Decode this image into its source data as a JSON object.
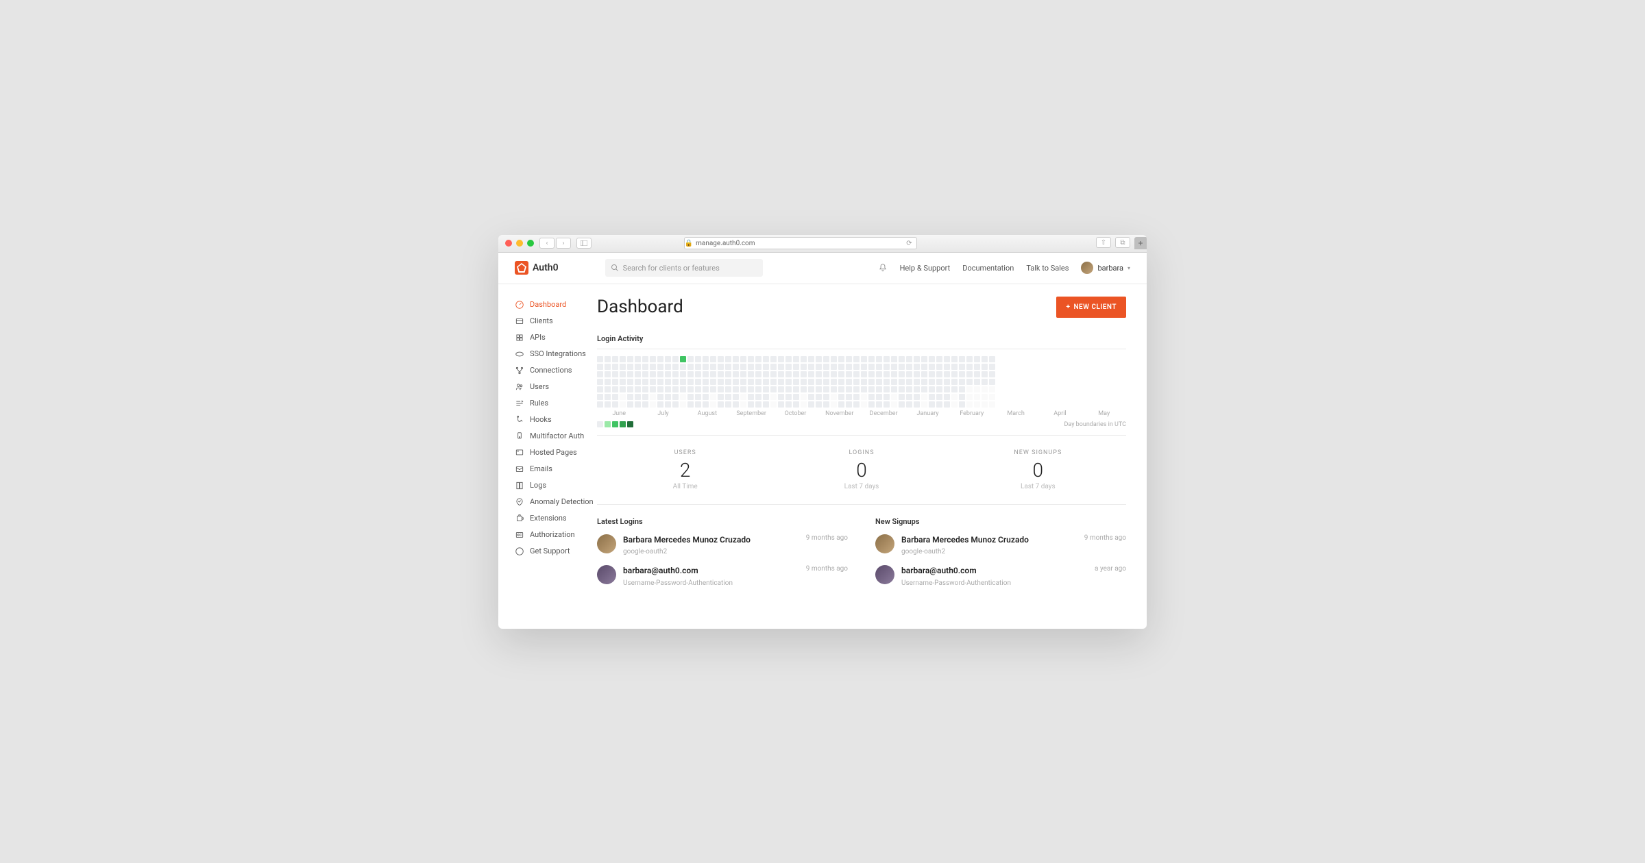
{
  "browser": {
    "url": "manage.auth0.com"
  },
  "brand": "Auth0",
  "search": {
    "placeholder": "Search for clients or features"
  },
  "topnav": {
    "help": "Help & Support",
    "docs": "Documentation",
    "sales": "Talk to Sales",
    "user": "barbara"
  },
  "sidebar": [
    {
      "icon": "dashboard",
      "label": "Dashboard",
      "active": true
    },
    {
      "icon": "clients",
      "label": "Clients"
    },
    {
      "icon": "apis",
      "label": "APIs"
    },
    {
      "icon": "sso",
      "label": "SSO Integrations"
    },
    {
      "icon": "connections",
      "label": "Connections"
    },
    {
      "icon": "users",
      "label": "Users"
    },
    {
      "icon": "rules",
      "label": "Rules"
    },
    {
      "icon": "hooks",
      "label": "Hooks"
    },
    {
      "icon": "mfa",
      "label": "Multifactor Auth"
    },
    {
      "icon": "hosted",
      "label": "Hosted Pages"
    },
    {
      "icon": "emails",
      "label": "Emails"
    },
    {
      "icon": "logs",
      "label": "Logs"
    },
    {
      "icon": "anomaly",
      "label": "Anomaly Detection"
    },
    {
      "icon": "extensions",
      "label": "Extensions"
    },
    {
      "icon": "authorization",
      "label": "Authorization"
    },
    {
      "icon": "support",
      "label": "Get Support"
    }
  ],
  "page": {
    "title": "Dashboard",
    "new_btn": "NEW CLIENT"
  },
  "activity": {
    "title": "Login Activity",
    "months": [
      "June",
      "July",
      "August",
      "September",
      "October",
      "November",
      "December",
      "January",
      "February",
      "March",
      "April",
      "May"
    ],
    "footer": "Day boundaries in UTC"
  },
  "stats": [
    {
      "label": "USERS",
      "value": "2",
      "sub": "All Time"
    },
    {
      "label": "LOGINS",
      "value": "0",
      "sub": "Last 7 days"
    },
    {
      "label": "NEW SIGNUPS",
      "value": "0",
      "sub": "Last 7 days"
    }
  ],
  "lists": {
    "logins": {
      "title": "Latest Logins",
      "items": [
        {
          "name": "Barbara Mercedes Munoz Cruzado",
          "meta": "google-oauth2",
          "time": "9 months ago",
          "av": ""
        },
        {
          "name": "barbara@auth0.com",
          "meta": "Username-Password-Authentication",
          "time": "9 months ago",
          "av": "alt"
        }
      ]
    },
    "signups": {
      "title": "New Signups",
      "items": [
        {
          "name": "Barbara Mercedes Munoz Cruzado",
          "meta": "google-oauth2",
          "time": "9 months ago",
          "av": ""
        },
        {
          "name": "barbara@auth0.com",
          "meta": "Username-Password-Authentication",
          "time": "a year ago",
          "av": "alt"
        }
      ]
    }
  }
}
